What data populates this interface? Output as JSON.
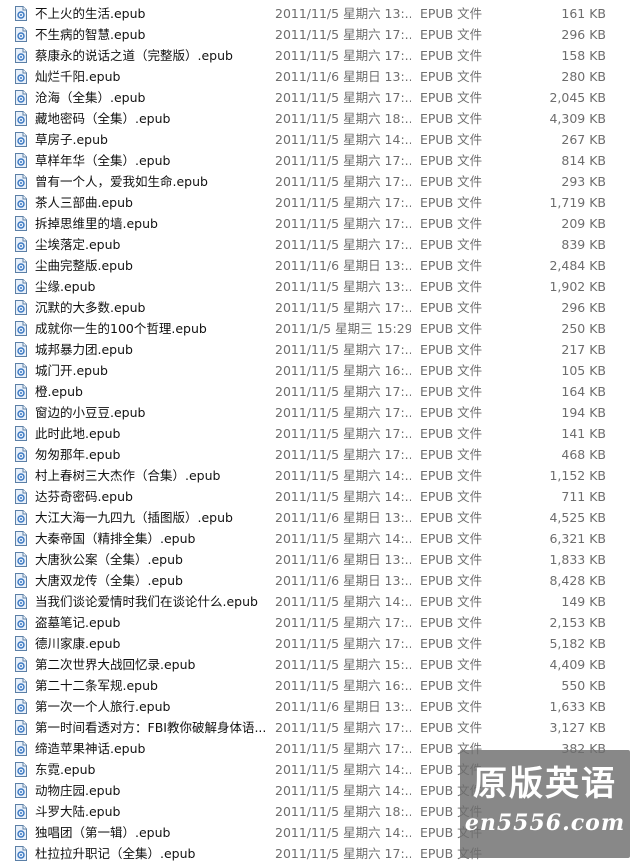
{
  "files": [
    {
      "name": "不上火的生活.epub",
      "date": "2011/11/5 星期六 13:...",
      "type": "EPUB 文件",
      "size": "161 KB"
    },
    {
      "name": "不生病的智慧.epub",
      "date": "2011/11/5 星期六 17:...",
      "type": "EPUB 文件",
      "size": "296 KB"
    },
    {
      "name": "蔡康永的说话之道（完整版）.epub",
      "date": "2011/11/5 星期六 17:...",
      "type": "EPUB 文件",
      "size": "158 KB"
    },
    {
      "name": "灿烂千阳.epub",
      "date": "2011/11/6 星期日 13:...",
      "type": "EPUB 文件",
      "size": "280 KB"
    },
    {
      "name": "沧海（全集）.epub",
      "date": "2011/11/5 星期六 17:...",
      "type": "EPUB 文件",
      "size": "2,045 KB"
    },
    {
      "name": "藏地密码（全集）.epub",
      "date": "2011/11/5 星期六 18:...",
      "type": "EPUB 文件",
      "size": "4,309 KB"
    },
    {
      "name": "草房子.epub",
      "date": "2011/11/5 星期六 14:...",
      "type": "EPUB 文件",
      "size": "267 KB"
    },
    {
      "name": "草样年华（全集）.epub",
      "date": "2011/11/5 星期六 17:...",
      "type": "EPUB 文件",
      "size": "814 KB"
    },
    {
      "name": "曾有一个人，爱我如生命.epub",
      "date": "2011/11/5 星期六 17:...",
      "type": "EPUB 文件",
      "size": "293 KB"
    },
    {
      "name": "茶人三部曲.epub",
      "date": "2011/11/5 星期六 17:...",
      "type": "EPUB 文件",
      "size": "1,719 KB"
    },
    {
      "name": "拆掉思维里的墙.epub",
      "date": "2011/11/5 星期六 17:...",
      "type": "EPUB 文件",
      "size": "209 KB"
    },
    {
      "name": "尘埃落定.epub",
      "date": "2011/11/5 星期六 17:...",
      "type": "EPUB 文件",
      "size": "839 KB"
    },
    {
      "name": "尘曲完整版.epub",
      "date": "2011/11/6 星期日 13:...",
      "type": "EPUB 文件",
      "size": "2,484 KB"
    },
    {
      "name": "尘缘.epub",
      "date": "2011/11/5 星期六 13:...",
      "type": "EPUB 文件",
      "size": "1,902 KB"
    },
    {
      "name": "沉默的大多数.epub",
      "date": "2011/11/5 星期六 17:...",
      "type": "EPUB 文件",
      "size": "296 KB"
    },
    {
      "name": "成就你一生的100个哲理.epub",
      "date": "2011/1/5 星期三 15:29",
      "type": "EPUB 文件",
      "size": "250 KB"
    },
    {
      "name": "城邦暴力团.epub",
      "date": "2011/11/5 星期六 17:...",
      "type": "EPUB 文件",
      "size": "217 KB"
    },
    {
      "name": "城门开.epub",
      "date": "2011/11/5 星期六 16:...",
      "type": "EPUB 文件",
      "size": "105 KB"
    },
    {
      "name": "橙.epub",
      "date": "2011/11/5 星期六 17:...",
      "type": "EPUB 文件",
      "size": "164 KB"
    },
    {
      "name": "窗边的小豆豆.epub",
      "date": "2011/11/5 星期六 17:...",
      "type": "EPUB 文件",
      "size": "194 KB"
    },
    {
      "name": "此时此地.epub",
      "date": "2011/11/5 星期六 17:...",
      "type": "EPUB 文件",
      "size": "141 KB"
    },
    {
      "name": "匆匆那年.epub",
      "date": "2011/11/5 星期六 17:...",
      "type": "EPUB 文件",
      "size": "468 KB"
    },
    {
      "name": "村上春树三大杰作（合集）.epub",
      "date": "2011/11/5 星期六 14:...",
      "type": "EPUB 文件",
      "size": "1,152 KB"
    },
    {
      "name": "达芬奇密码.epub",
      "date": "2011/11/5 星期六 14:...",
      "type": "EPUB 文件",
      "size": "711 KB"
    },
    {
      "name": "大江大海一九四九（插图版）.epub",
      "date": "2011/11/6 星期日 13:...",
      "type": "EPUB 文件",
      "size": "4,525 KB"
    },
    {
      "name": "大秦帝国（精排全集）.epub",
      "date": "2011/11/5 星期六 14:...",
      "type": "EPUB 文件",
      "size": "6,321 KB"
    },
    {
      "name": "大唐狄公案（全集）.epub",
      "date": "2011/11/6 星期日 13:...",
      "type": "EPUB 文件",
      "size": "1,833 KB"
    },
    {
      "name": "大唐双龙传（全集）.epub",
      "date": "2011/11/6 星期日 13:...",
      "type": "EPUB 文件",
      "size": "8,428 KB"
    },
    {
      "name": "当我们谈论爱情时我们在谈论什么.epub",
      "date": "2011/11/5 星期六 14:...",
      "type": "EPUB 文件",
      "size": "149 KB"
    },
    {
      "name": "盗墓笔记.epub",
      "date": "2011/11/5 星期六 17:...",
      "type": "EPUB 文件",
      "size": "2,153 KB"
    },
    {
      "name": "德川家康.epub",
      "date": "2011/11/5 星期六 17:...",
      "type": "EPUB 文件",
      "size": "5,182 KB"
    },
    {
      "name": "第二次世界大战回忆录.epub",
      "date": "2011/11/5 星期六 15:...",
      "type": "EPUB 文件",
      "size": "4,409 KB"
    },
    {
      "name": "第二十二条军规.epub",
      "date": "2011/11/5 星期六 16:...",
      "type": "EPUB 文件",
      "size": "550 KB"
    },
    {
      "name": "第一次一个人旅行.epub",
      "date": "2011/11/6 星期日 13:...",
      "type": "EPUB 文件",
      "size": "1,633 KB"
    },
    {
      "name": "第一时间看透对方：FBI教你破解身体语...",
      "date": "2011/11/5 星期六 17:...",
      "type": "EPUB 文件",
      "size": "3,127 KB"
    },
    {
      "name": "缔造苹果神话.epub",
      "date": "2011/11/5 星期六 17:...",
      "type": "EPUB 文件",
      "size": "382 KB"
    },
    {
      "name": "东霓.epub",
      "date": "2011/11/5 星期六 14:...",
      "type": "EPUB 文件",
      "size": ""
    },
    {
      "name": "动物庄园.epub",
      "date": "2011/11/5 星期六 14:...",
      "type": "EPUB 文件",
      "size": ""
    },
    {
      "name": "斗罗大陆.epub",
      "date": "2011/11/5 星期六 18:...",
      "type": "EPUB 文件",
      "size": ""
    },
    {
      "name": "独唱团（第一辑）.epub",
      "date": "2011/11/5 星期六 14:...",
      "type": "EPUB 文件",
      "size": ""
    },
    {
      "name": "杜拉拉升职记（全集）.epub",
      "date": "2011/11/5 星期六 17:...",
      "type": "EPUB 文件",
      "size": ""
    }
  ],
  "watermark": {
    "title": "原版英语",
    "subtitle": "en5556.com"
  },
  "colors": {
    "icon_border": "#5b7fa6",
    "icon_fill": "#e8f0fa",
    "icon_ring": "#3a78c2",
    "text_primary": "#111111",
    "text_secondary": "#6d6d6d"
  },
  "icon_name": "epub-file-icon"
}
